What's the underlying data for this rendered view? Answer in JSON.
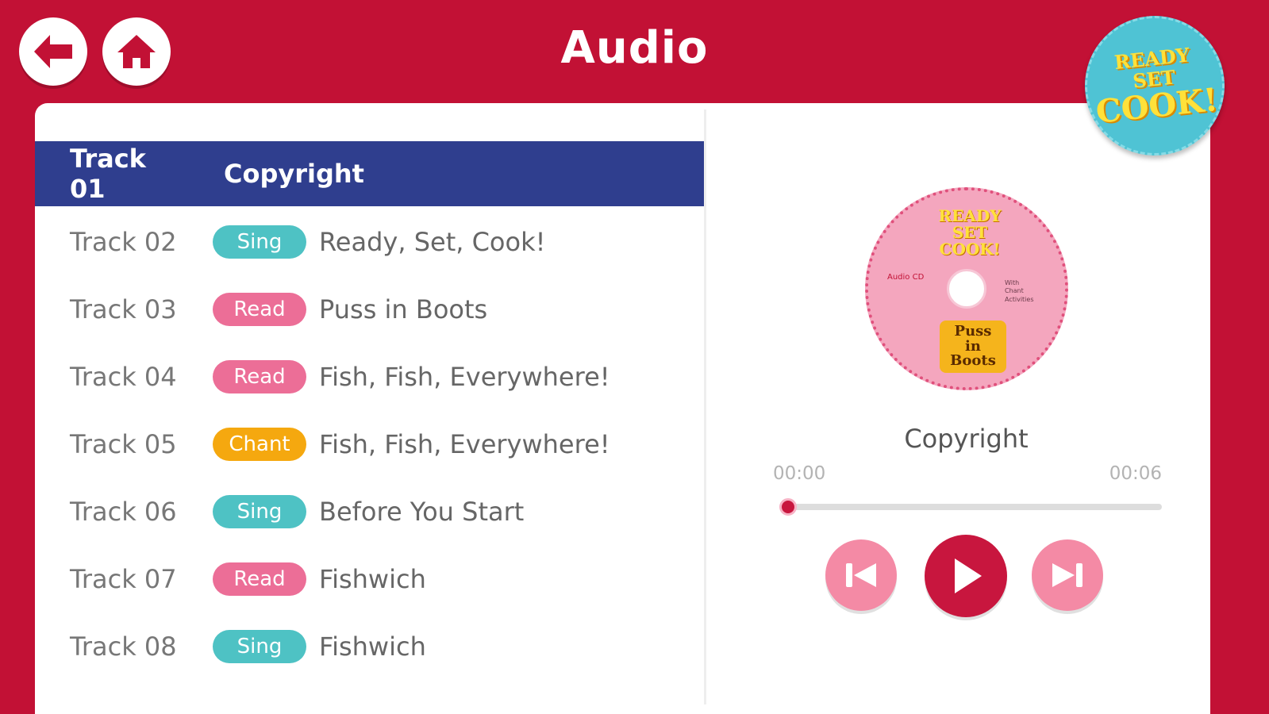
{
  "header": {
    "title": "Audio",
    "back_icon": "arrow-left-icon",
    "home_icon": "home-icon"
  },
  "logo": {
    "line1": "READY",
    "line2": "SET",
    "line3": "COOK!"
  },
  "tracks": [
    {
      "number": "Track 01",
      "badge": "",
      "badge_type": "",
      "title": "Copyright",
      "active": true
    },
    {
      "number": "Track 02",
      "badge": "Sing",
      "badge_type": "sing",
      "title": "Ready, Set, Cook!",
      "active": false
    },
    {
      "number": "Track 03",
      "badge": "Read",
      "badge_type": "read",
      "title": "Puss in Boots",
      "active": false
    },
    {
      "number": "Track 04",
      "badge": "Read",
      "badge_type": "read",
      "title": "Fish, Fish, Everywhere!",
      "active": false
    },
    {
      "number": "Track 05",
      "badge": "Chant",
      "badge_type": "chant",
      "title": "Fish, Fish, Everywhere!",
      "active": false
    },
    {
      "number": "Track 06",
      "badge": "Sing",
      "badge_type": "sing",
      "title": "Before You Start",
      "active": false
    },
    {
      "number": "Track 07",
      "badge": "Read",
      "badge_type": "read",
      "title": "Fishwich",
      "active": false
    },
    {
      "number": "Track 08",
      "badge": "Sing",
      "badge_type": "sing",
      "title": "Fishwich",
      "active": false
    }
  ],
  "player": {
    "cd": {
      "line1": "READY",
      "line2": "SET",
      "line3": "COOK!",
      "label_left": "Audio CD",
      "label_right": [
        "With",
        "Chant",
        "Activities"
      ],
      "box_line1": "Puss",
      "box_line2": "in",
      "box_line3": "Boots"
    },
    "now_playing": "Copyright",
    "time_start": "00:00",
    "time_end": "00:06",
    "progress": 0.02
  },
  "colors": {
    "brand_red": "#c21135",
    "active_row": "#2f3e8e",
    "sing": "#4ec2c4",
    "read": "#ec6e97",
    "chant": "#f5a80f"
  }
}
